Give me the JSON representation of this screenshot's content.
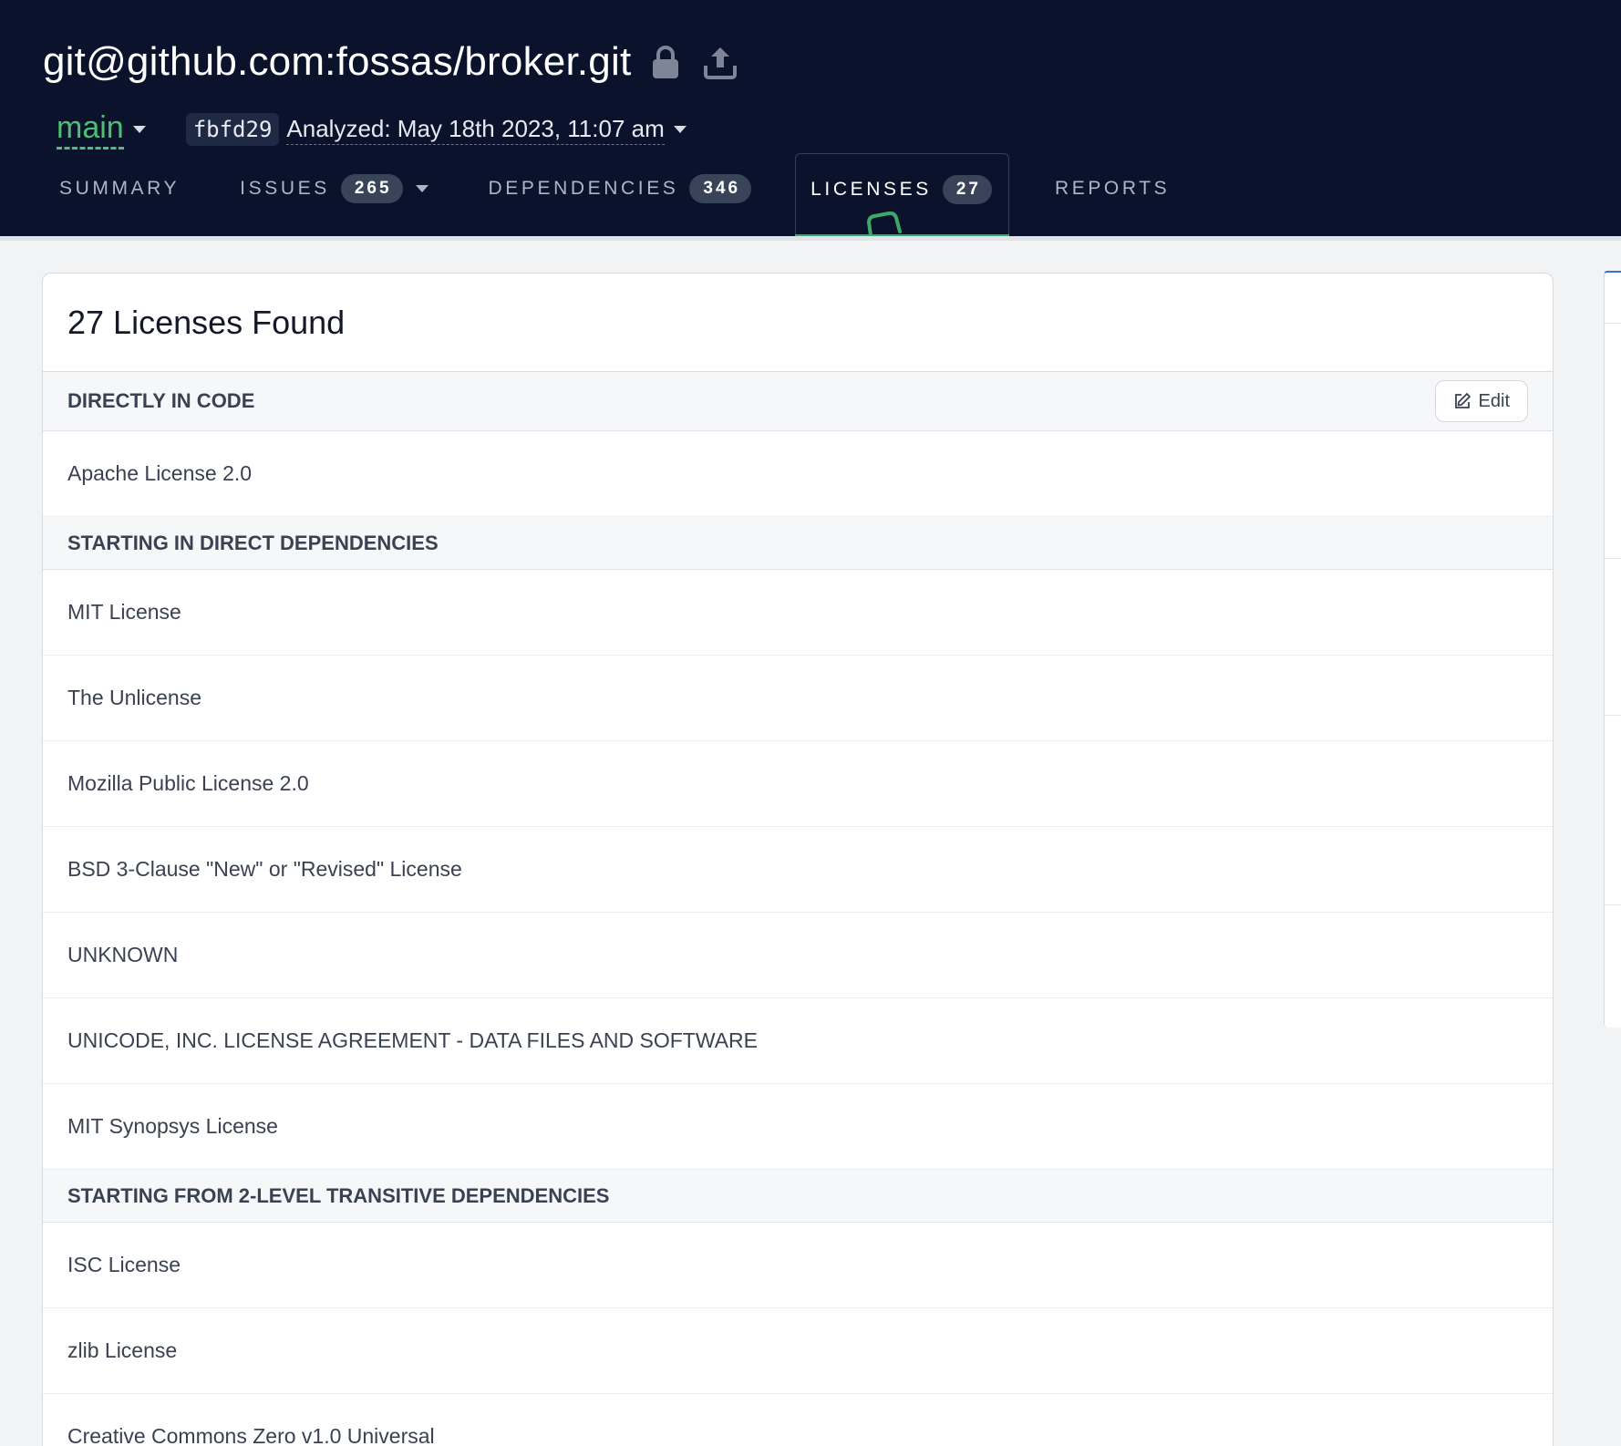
{
  "header": {
    "repo_title": "git@github.com:fossas/broker.git",
    "branch": "main",
    "commit_sha": "fbfd29",
    "analyzed_label": "Analyzed: May 18th 2023, 11:07 am"
  },
  "tabs": [
    {
      "label": "SUMMARY",
      "count": null,
      "active": false
    },
    {
      "label": "ISSUES",
      "count": "265",
      "active": false,
      "dropdown": true
    },
    {
      "label": "DEPENDENCIES",
      "count": "346",
      "active": false
    },
    {
      "label": "LICENSES",
      "count": "27",
      "active": true
    },
    {
      "label": "REPORTS",
      "count": null,
      "active": false
    }
  ],
  "card": {
    "title": "27 Licenses Found",
    "edit_label": "Edit",
    "sections": [
      {
        "heading": "DIRECTLY IN CODE",
        "items": [
          "Apache License 2.0"
        ]
      },
      {
        "heading": "STARTING IN DIRECT DEPENDENCIES",
        "items": [
          "MIT License",
          "The Unlicense",
          "Mozilla Public License 2.0",
          "BSD 3-Clause \"New\" or \"Revised\" License",
          "UNKNOWN",
          "UNICODE, INC. LICENSE AGREEMENT - DATA FILES AND SOFTWARE",
          "MIT Synopsys License"
        ]
      },
      {
        "heading": "STARTING FROM 2-LEVEL TRANSITIVE DEPENDENCIES",
        "items": [
          "ISC License",
          "zlib License",
          "Creative Commons Zero v1.0 Universal"
        ]
      }
    ]
  },
  "colors": {
    "header_bg": "#0a132b",
    "branch_green": "#4fbf73",
    "active_tab_underline": "#3ea86a",
    "page_bg": "#f2f3f5"
  },
  "icons": [
    "lock-icon",
    "upload-icon",
    "chevron-down-icon",
    "edit-icon"
  ]
}
